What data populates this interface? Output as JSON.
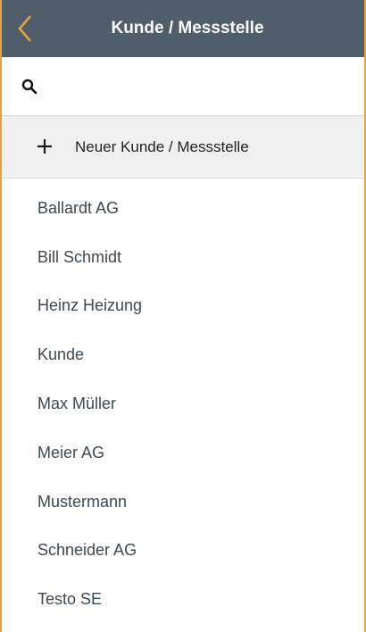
{
  "header": {
    "back_icon": "chevron-left-icon",
    "title": "Kunde / Messstelle"
  },
  "search": {
    "icon": "search-icon",
    "value": "",
    "placeholder": ""
  },
  "new_entry": {
    "icon": "plus-icon",
    "label": "Neuer Kunde / Messstelle"
  },
  "customers": [
    {
      "name": "Ballardt AG"
    },
    {
      "name": "Bill Schmidt"
    },
    {
      "name": "Heinz Heizung"
    },
    {
      "name": "Kunde"
    },
    {
      "name": "Max Müller"
    },
    {
      "name": "Meier AG"
    },
    {
      "name": "Mustermann"
    },
    {
      "name": "Schneider AG"
    },
    {
      "name": "Testo SE"
    }
  ],
  "colors": {
    "header_bg": "#4f5e6a",
    "accent": "#e8a33c",
    "row_bg": "#f0f0f0"
  }
}
